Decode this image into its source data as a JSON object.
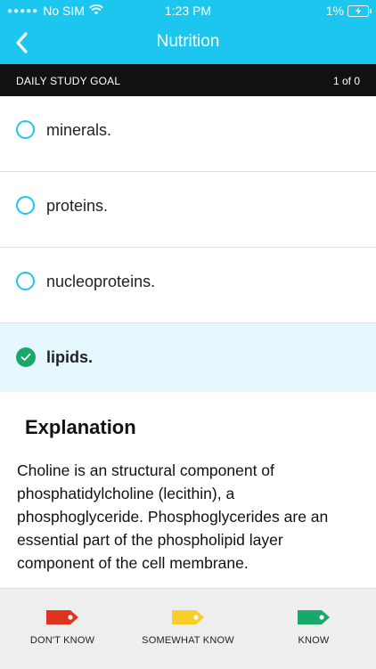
{
  "status_bar": {
    "carrier": "No SIM",
    "time": "1:23 PM",
    "battery": "1%"
  },
  "header": {
    "title": "Nutrition",
    "back_icon": "chevron-left-icon"
  },
  "goal_bar": {
    "label": "DAILY STUDY GOAL",
    "progress": "1 of 0"
  },
  "options": [
    {
      "label": "minerals.",
      "selected": false
    },
    {
      "label": "proteins.",
      "selected": false
    },
    {
      "label": "nucleoproteins.",
      "selected": false
    },
    {
      "label": "lipids.",
      "selected": true
    }
  ],
  "explanation": {
    "title": "Explanation",
    "text": "Choline is an structural component of phosphatidylcholine (lecithin), a phosphoglyceride. Phosphoglycerides are an essential part of the phospholipid layer component of the cell membrane."
  },
  "knowledge_buttons": [
    {
      "label": "DON'T KNOW",
      "color": "#e0331e"
    },
    {
      "label": "SOMEWHAT KNOW",
      "color": "#f7cf2a"
    },
    {
      "label": "KNOW",
      "color": "#1aa86a"
    }
  ],
  "colors": {
    "accent": "#1cc6ef",
    "selected_bg": "#e6f8fd",
    "correct": "#1aa86a"
  }
}
